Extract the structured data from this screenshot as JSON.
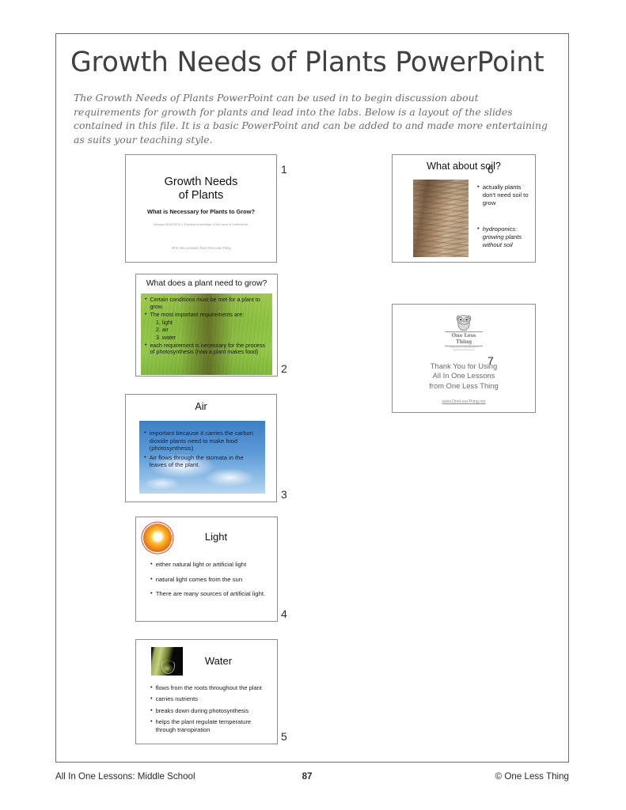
{
  "document": {
    "title": "Growth Needs of Plants PowerPoint",
    "intro": "The Growth Needs of Plants PowerPoint can be used in to begin discussion about requirements for growth for plants and lead into the labs. Below is a layout of the slides contained in this file. It is a basic PowerPoint and can be added to and made more entertaining as suits your teaching style."
  },
  "slides": [
    {
      "number": "1",
      "title_line1": "Growth Needs",
      "title_line2": "of Plants",
      "subtitle": "What is Necessary for Plants to Grow?",
      "standard": "Georgia MSAGED4-1 Express knowledge of the area of horticulture.",
      "footer": "All In One Lessons from One Less Thing"
    },
    {
      "number": "2",
      "title": "What does a plant need to grow?",
      "bullets": [
        "Certain conditions must be met for a plant to grow.",
        "The most important requirements are:"
      ],
      "numbered": [
        "1. light",
        "2. air",
        "3. water"
      ],
      "bullet_last": "each requirement is necessary for the process of photosynthesis (how a plant makes food)"
    },
    {
      "number": "3",
      "title": "Air",
      "bullets": [
        "important because it carries the carbon dioxide plants need to make food (photosynthesis)",
        "Air flows through the stomata in the leaves of the plant."
      ]
    },
    {
      "number": "4",
      "title": "Light",
      "bullets": [
        "either natural light or artificial light",
        "natural light comes from the sun",
        "There are many sources of artificial light."
      ]
    },
    {
      "number": "5",
      "title": "Water",
      "bullets": [
        "flows from the roots throughout the plant",
        "carries nutrients",
        "breaks down during photosynthesis",
        "helps the plant regulate temperature through transpiration"
      ]
    },
    {
      "number": "6",
      "title": "What about soil?",
      "bullet1": "actually plants don't need soil to grow",
      "bullet2": "hydroponics: growing plants without soil"
    },
    {
      "number": "7",
      "logo_name": "One Less Thing",
      "logo_tagline": "Resources for Excellence in Agricultural Education",
      "thanks_line1": "Thank You for Using",
      "thanks_line2": "All In One Lessons",
      "thanks_line3": "from One Less Thing",
      "url": "www.OneLessThing.net"
    }
  ],
  "bullet_glyph": "•",
  "footer": {
    "left": "All In One Lessons: Middle School",
    "page": "87",
    "right": "© One Less Thing"
  }
}
